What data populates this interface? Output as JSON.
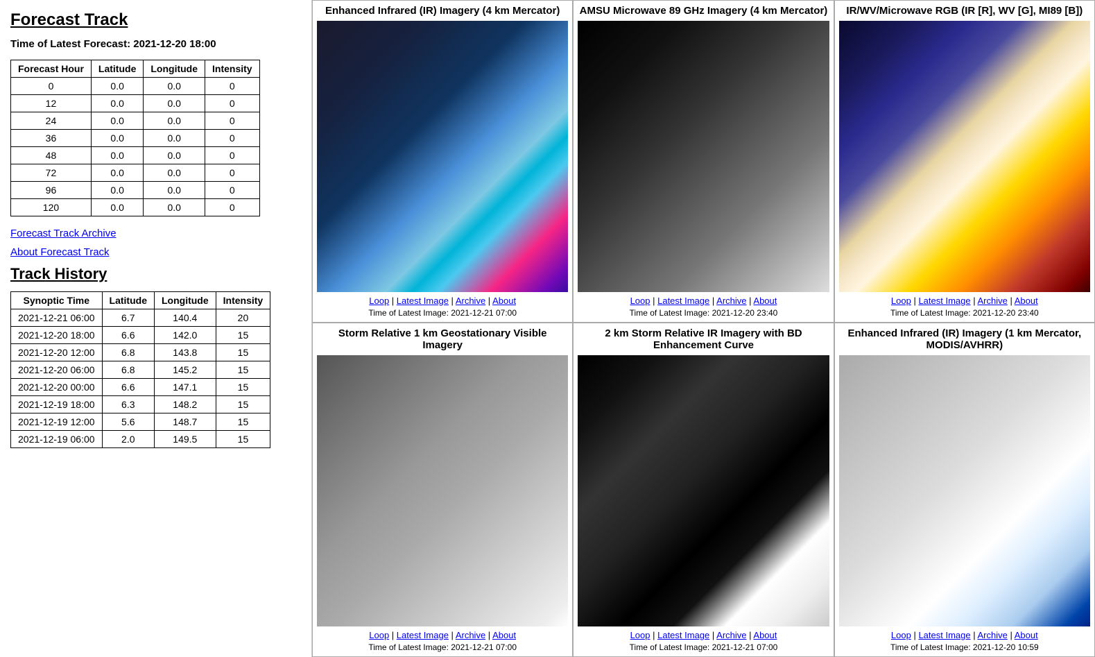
{
  "leftPanel": {
    "title": "Forecast Track",
    "latestForecastLabel": "Time of Latest Forecast:",
    "latestForecastTime": "2021-12-20 18:00",
    "forecastTable": {
      "headers": [
        "Forecast Hour",
        "Latitude",
        "Longitude",
        "Intensity"
      ],
      "rows": [
        [
          "0",
          "0.0",
          "0.0",
          "0"
        ],
        [
          "12",
          "0.0",
          "0.0",
          "0"
        ],
        [
          "24",
          "0.0",
          "0.0",
          "0"
        ],
        [
          "36",
          "0.0",
          "0.0",
          "0"
        ],
        [
          "48",
          "0.0",
          "0.0",
          "0"
        ],
        [
          "72",
          "0.0",
          "0.0",
          "0"
        ],
        [
          "96",
          "0.0",
          "0.0",
          "0"
        ],
        [
          "120",
          "0.0",
          "0.0",
          "0"
        ]
      ]
    },
    "archiveLink": "Forecast Track Archive",
    "aboutLink": "About Forecast Track",
    "trackHistoryTitle": "Track History",
    "trackHistoryTable": {
      "headers": [
        "Synoptic Time",
        "Latitude",
        "Longitude",
        "Intensity"
      ],
      "rows": [
        [
          "2021-12-21 06:00",
          "6.7",
          "140.4",
          "20"
        ],
        [
          "2021-12-20 18:00",
          "6.6",
          "142.0",
          "15"
        ],
        [
          "2021-12-20 12:00",
          "6.8",
          "143.8",
          "15"
        ],
        [
          "2021-12-20 06:00",
          "6.8",
          "145.2",
          "15"
        ],
        [
          "2021-12-20 00:00",
          "6.6",
          "147.1",
          "15"
        ],
        [
          "2021-12-19 18:00",
          "6.3",
          "148.2",
          "15"
        ],
        [
          "2021-12-19 12:00",
          "5.6",
          "148.7",
          "15"
        ],
        [
          "2021-12-19 06:00",
          "2.0",
          "149.5",
          "15"
        ]
      ]
    }
  },
  "rightPanel": {
    "cells": [
      {
        "id": "cell-ir-enhanced",
        "title": "Enhanced Infrared (IR) Imagery (4 km Mercator)",
        "imgStyle": "ir-img",
        "links": [
          "Loop",
          "Latest Image",
          "Archive",
          "About"
        ],
        "time": "Time of Latest Image: 2021-12-21 07:00"
      },
      {
        "id": "cell-amsu",
        "title": "AMSU Microwave 89 GHz Imagery (4 km Mercator)",
        "imgStyle": "amsu-img",
        "links": [
          "Loop",
          "Latest Image",
          "Archive",
          "About"
        ],
        "time": "Time of Latest Image: 2021-12-20 23:40"
      },
      {
        "id": "cell-rgb",
        "title": "IR/WV/Microwave RGB (IR [R], WV [G], MI89 [B])",
        "imgStyle": "rgb-img",
        "links": [
          "Loop",
          "Latest Image",
          "Archive",
          "About"
        ],
        "time": "Time of Latest Image: 2021-12-20 23:40"
      },
      {
        "id": "cell-vis",
        "title": "Storm Relative 1 km Geostationary Visible Imagery",
        "imgStyle": "vis-img",
        "links": [
          "Loop",
          "Latest Image",
          "Archive",
          "About"
        ],
        "time": "Time of Latest Image: 2021-12-21 07:00"
      },
      {
        "id": "cell-bd",
        "title": "2 km Storm Relative IR Imagery with BD Enhancement Curve",
        "imgStyle": "bd-img",
        "links": [
          "Loop",
          "Latest Image",
          "Archive",
          "About"
        ],
        "time": "Time of Latest Image: 2021-12-21 07:00"
      },
      {
        "id": "cell-modis",
        "title": "Enhanced Infrared (IR) Imagery (1 km Mercator, MODIS/AVHRR)",
        "imgStyle": "modis-img",
        "links": [
          "Loop",
          "Latest Image",
          "Archive",
          "About"
        ],
        "time": "Time of Latest Image: 2021-12-20 10:59"
      }
    ]
  }
}
